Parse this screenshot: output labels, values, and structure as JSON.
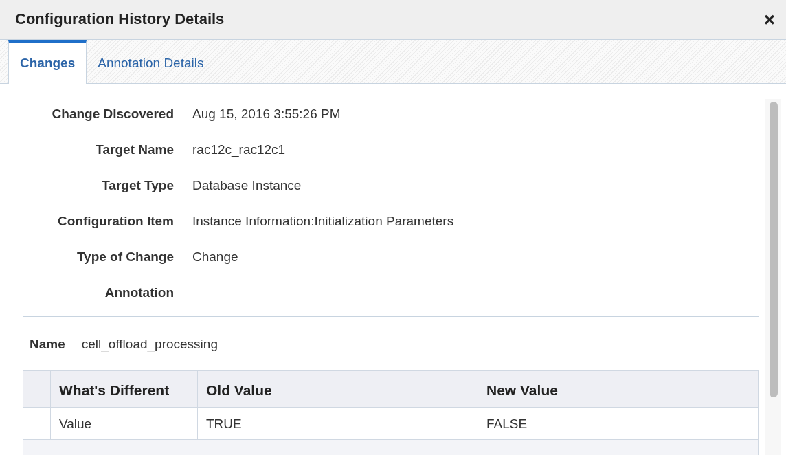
{
  "window": {
    "title": "Configuration History Details",
    "close": "×"
  },
  "tabs": [
    {
      "label": "Changes",
      "selected": true
    },
    {
      "label": "Annotation Details",
      "selected": false
    }
  ],
  "details": [
    {
      "label": "Change Discovered",
      "value": "Aug 15, 2016 3:55:26 PM"
    },
    {
      "label": "Target Name",
      "value": "rac12c_rac12c1"
    },
    {
      "label": "Target Type",
      "value": "Database Instance"
    },
    {
      "label": "Configuration Item",
      "value": "Instance Information:Initialization Parameters"
    },
    {
      "label": "Type of Change",
      "value": "Change"
    },
    {
      "label": "Annotation"
    }
  ],
  "name": {
    "label": "Name",
    "value": "cell_offload_processing"
  },
  "table": {
    "columns": [
      "What's Different",
      "Old Value",
      "New Value"
    ],
    "rows": [
      [
        "Value",
        "TRUE",
        "FALSE"
      ]
    ]
  }
}
